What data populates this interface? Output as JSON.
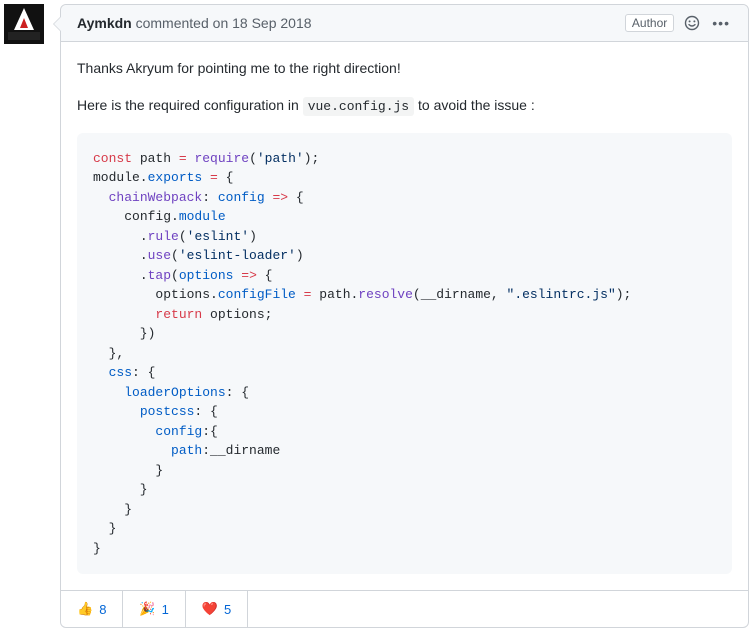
{
  "author": "Aymkdn",
  "commented_word": "commented",
  "on_word": "on",
  "date": "18 Sep 2018",
  "author_badge": "Author",
  "body": {
    "p1": "Thanks Akryum for pointing me to the right direction!",
    "p2_a": "Here is the required configuration in ",
    "p2_code": "vue.config.js",
    "p2_b": " to avoid the issue :"
  },
  "code": {
    "l0_kw": "const",
    "l0_a": " path ",
    "l0_eq": "=",
    "l0_fn": " require",
    "l0_p": "(",
    "l0_s": "'path'",
    "l0_e": ");",
    "l1_a": "module.",
    "l1_exp": "exports",
    "l1_b": " ",
    "l1_eq": "=",
    "l1_c": " {",
    "l2_pad": "  ",
    "l2_k": "chainWebpack",
    "l2_a": ": ",
    "l2_arg": "config",
    "l2_b": " ",
    "l2_arrow": "=>",
    "l2_c": " {",
    "l3_pad": "    ",
    "l3_a": "config.",
    "l3_mod": "module",
    "l4_pad": "      ",
    "l4_a": ".",
    "l4_fn": "rule",
    "l4_b": "(",
    "l4_s": "'eslint'",
    "l4_c": ")",
    "l5_pad": "      ",
    "l5_a": ".",
    "l5_fn": "use",
    "l5_b": "(",
    "l5_s": "'eslint-loader'",
    "l5_c": ")",
    "l6_pad": "      ",
    "l6_a": ".",
    "l6_fn": "tap",
    "l6_b": "(",
    "l6_arg": "options",
    "l6_c": " ",
    "l6_arrow": "=>",
    "l6_d": " {",
    "l7_pad": "        ",
    "l7_a": "options.",
    "l7_k": "configFile",
    "l7_b": " ",
    "l7_eq": "=",
    "l7_c": " path.",
    "l7_fn": "resolve",
    "l7_d": "(__dirname, ",
    "l7_s": "\".eslintrc.js\"",
    "l7_e": ");",
    "l8_pad": "        ",
    "l8_kw": "return",
    "l8_a": " options;",
    "l9": "      })",
    "l10": "  },",
    "l11_pad": "  ",
    "l11_k": "css",
    "l11_a": ": {",
    "l12_pad": "    ",
    "l12_k": "loaderOptions",
    "l12_a": ": {",
    "l13_pad": "      ",
    "l13_k": "postcss",
    "l13_a": ": {",
    "l14_pad": "        ",
    "l14_k": "config",
    "l14_a": ":{",
    "l15_pad": "          ",
    "l15_k": "path",
    "l15_a": ":__dirname",
    "l16": "        }",
    "l17": "      }",
    "l18": "    }",
    "l19": "  }",
    "l20": "}"
  },
  "reactions": [
    {
      "emoji": "👍",
      "count": "8"
    },
    {
      "emoji": "🎉",
      "count": "1"
    },
    {
      "emoji": "❤️",
      "count": "5"
    }
  ]
}
